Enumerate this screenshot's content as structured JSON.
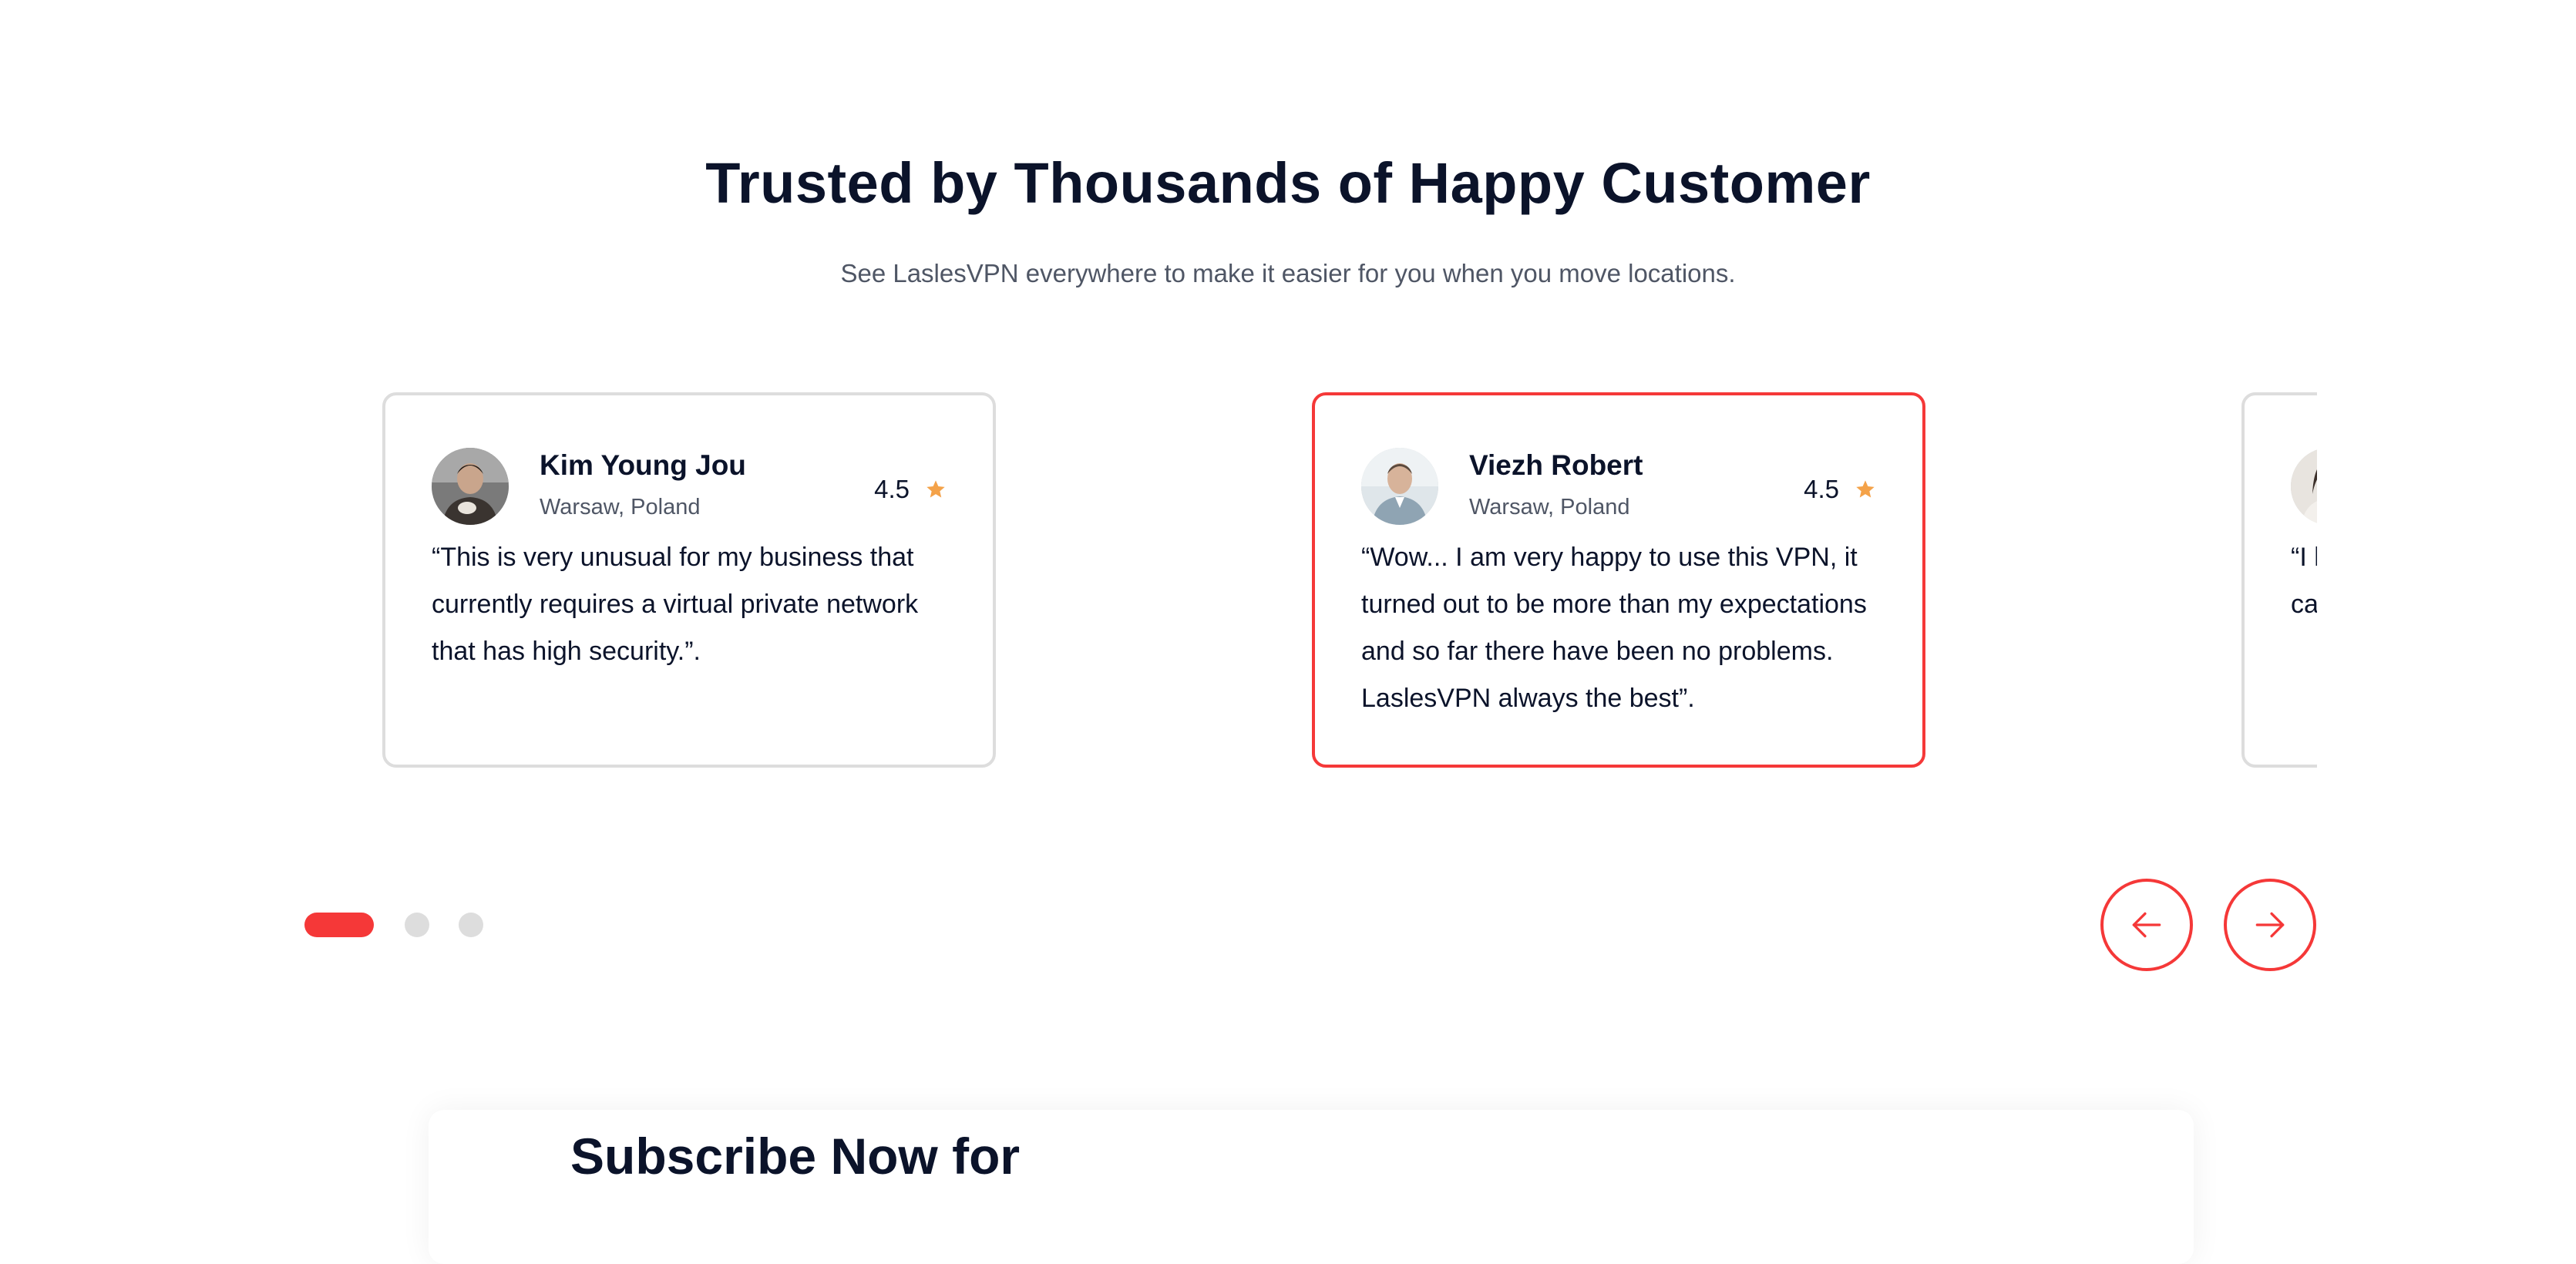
{
  "colors": {
    "accent": "#f53838",
    "heading": "#0b132a",
    "muted": "#4f5665",
    "card_border": "#dddddd",
    "star": "#f4a249"
  },
  "testimonials": {
    "title": "Trusted by Thousands of Happy Customer",
    "subtitle": "See LaslesVPN everywhere to make it easier for you when you move locations.",
    "cards": [
      {
        "name": "Kim Young Jou",
        "location": "Warsaw, Poland",
        "rating": "4.5",
        "quote": "“This is very unusual for my business that currently requires a virtual private network that has high security.”.",
        "icon": "star-icon",
        "active": false
      },
      {
        "name": "Viezh Robert",
        "location": "Warsaw, Poland",
        "rating": "4.5",
        "quote": "“Wow... I am very happy to use this VPN, it turned out to be more than my expectations and so far there have been no problems. LaslesVPN always the best”.",
        "icon": "star-icon",
        "active": true
      },
      {
        "name": "",
        "location": "",
        "rating": "",
        "quote": "“I l ca",
        "icon": "star-icon",
        "active": false
      }
    ],
    "pagination": {
      "total": 3,
      "current": 1
    },
    "nav": {
      "prev_icon": "arrow-left-icon",
      "next_icon": "arrow-right-icon"
    }
  },
  "subscribe": {
    "title": "Subscribe Now for"
  }
}
